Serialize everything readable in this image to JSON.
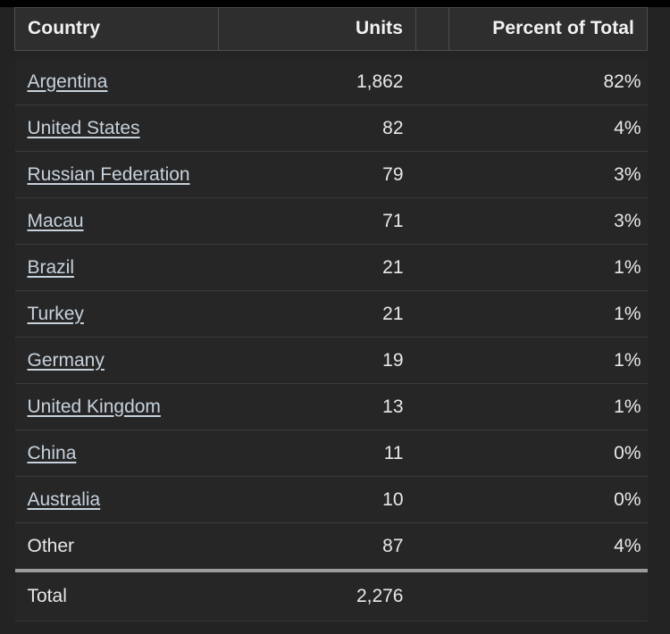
{
  "table": {
    "columns": [
      {
        "key": "country",
        "label": "Country",
        "align": "left"
      },
      {
        "key": "units",
        "label": "Units",
        "align": "right"
      },
      {
        "key": "gap",
        "label": "",
        "align": "left"
      },
      {
        "key": "percent",
        "label": "Percent of Total",
        "align": "right"
      }
    ],
    "rows": [
      {
        "country": "Argentina",
        "units": "1,862",
        "percent": "82%",
        "link": true
      },
      {
        "country": "United States",
        "units": "82",
        "percent": "4%",
        "link": true
      },
      {
        "country": "Russian Federation",
        "units": "79",
        "percent": "3%",
        "link": true
      },
      {
        "country": "Macau",
        "units": "71",
        "percent": "3%",
        "link": true
      },
      {
        "country": "Brazil",
        "units": "21",
        "percent": "1%",
        "link": true
      },
      {
        "country": "Turkey",
        "units": "21",
        "percent": "1%",
        "link": true
      },
      {
        "country": "Germany",
        "units": "19",
        "percent": "1%",
        "link": true
      },
      {
        "country": "United Kingdom",
        "units": "13",
        "percent": "1%",
        "link": true
      },
      {
        "country": "China",
        "units": "11",
        "percent": "0%",
        "link": true
      },
      {
        "country": "Australia",
        "units": "10",
        "percent": "0%",
        "link": true
      },
      {
        "country": "Other",
        "units": "87",
        "percent": "4%",
        "link": false
      }
    ],
    "total": {
      "country": "Total",
      "units": "2,276",
      "percent": ""
    }
  },
  "chart_data": {
    "type": "table",
    "title": "",
    "categories": [
      "Argentina",
      "United States",
      "Russian Federation",
      "Macau",
      "Brazil",
      "Turkey",
      "Germany",
      "United Kingdom",
      "China",
      "Australia",
      "Other"
    ],
    "series": [
      {
        "name": "Units",
        "values": [
          1862,
          82,
          79,
          71,
          21,
          21,
          19,
          13,
          11,
          10,
          87
        ]
      },
      {
        "name": "Percent of Total",
        "values": [
          82,
          4,
          3,
          3,
          1,
          1,
          1,
          1,
          0,
          0,
          4
        ]
      }
    ],
    "total_units": 2276,
    "xlabel": "Country",
    "ylabel": "Units"
  },
  "colors": {
    "page_background": "#232323",
    "row_background": "#262626",
    "header_background": "#2e2e2e",
    "header_border": "#4d4d4d",
    "row_divider": "#3b3b3b",
    "total_divider": "#9b9b9b",
    "text": "#e8e8e8",
    "link": "#c7d2dc"
  }
}
